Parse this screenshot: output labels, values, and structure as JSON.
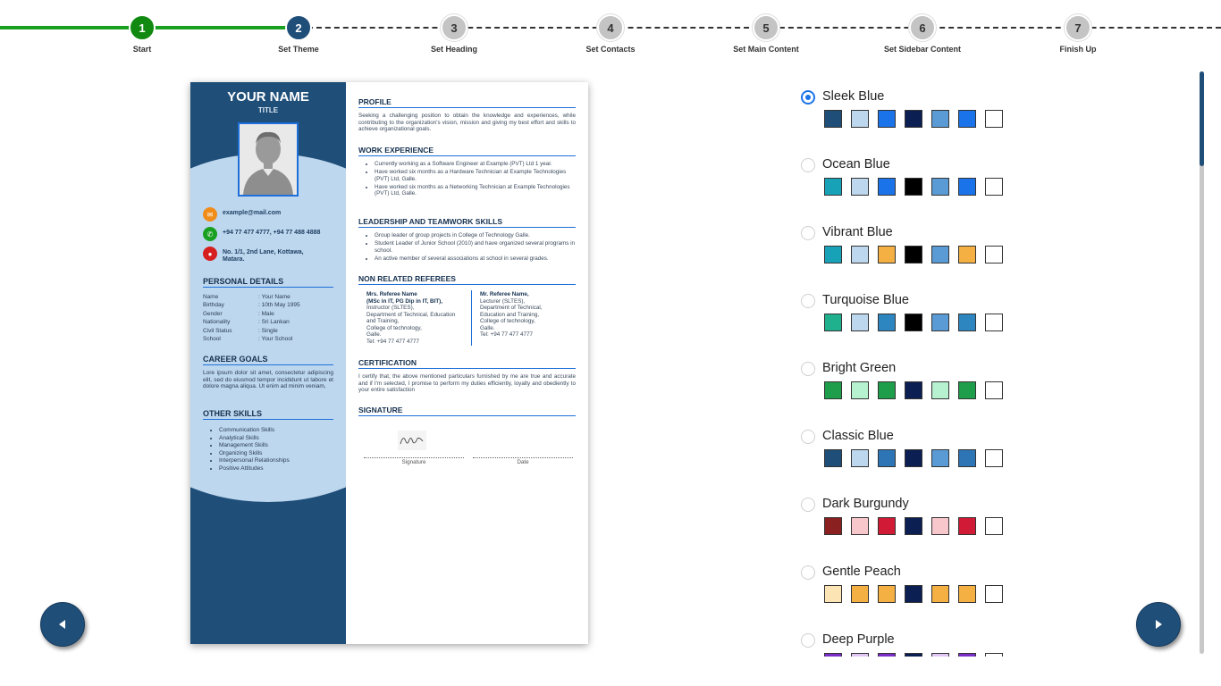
{
  "stepper": {
    "steps": [
      {
        "number": "1",
        "label": "Start",
        "state": "done"
      },
      {
        "number": "2",
        "label": "Set Theme",
        "state": "active"
      },
      {
        "number": "3",
        "label": "Set Heading",
        "state": "todo"
      },
      {
        "number": "4",
        "label": "Set Contacts",
        "state": "todo"
      },
      {
        "number": "5",
        "label": "Set Main Content",
        "state": "todo"
      },
      {
        "number": "6",
        "label": "Set Sidebar Content",
        "state": "todo"
      },
      {
        "number": "7",
        "label": "Finish Up",
        "state": "todo"
      }
    ]
  },
  "resume": {
    "name": "YOUR NAME",
    "title": "TITLE",
    "contacts": {
      "email": "example@mail.com",
      "phone": "+94 77 477 4777, +94 77 488 4888",
      "address": "No. 1/1, 2nd Lane, Kottawa, Matara."
    },
    "personal_details": {
      "heading": "PERSONAL DETAILS",
      "rows": [
        {
          "key": "Name",
          "value": ": Your Name"
        },
        {
          "key": "Birthday",
          "value": ": 10th May 1995"
        },
        {
          "key": "Gender",
          "value": ": Male"
        },
        {
          "key": "Nationality",
          "value": ": Sri Lankan"
        },
        {
          "key": "Civil Status",
          "value": ": Single"
        },
        {
          "key": "School",
          "value": ": Your School"
        }
      ]
    },
    "career_goals": {
      "heading": "CAREER GOALS",
      "text": "Lore ipsum dolor sit amet, consectetur adipiscing elit, sed do eiusmod tempor incididunt ut labore et dolore magna aliqua. Ut enim ad minim veniam,"
    },
    "other_skills": {
      "heading": "OTHER SKILLS",
      "items": [
        "Communication Skills",
        "Analytical Skills",
        "Management Skills",
        "Organizing Skills",
        "Interpersonal Relationships",
        "Positive Attitudes"
      ]
    },
    "profile": {
      "heading": "PROFILE",
      "text": "Seeking a challenging position to obtain the knowledge and experiences, while contributing to the organization's vision, mission and giving my best effort and skills to achieve organizational goals."
    },
    "work_experience": {
      "heading": "WORK EXPERIENCE",
      "items": [
        "Currently working as a Software Engineer at Example (PVT) Ltd   1 year.",
        "Have worked six months as a Hardware Technician at Example Technologies (PVT) Ltd, Galle.",
        "Have worked six months as a Networking Technician at Example Technologies (PVT) Ltd, Galle."
      ]
    },
    "leadership": {
      "heading": "LEADERSHIP AND TEAMWORK SKILLS",
      "items": [
        "Group leader of group projects in College of Technology   Galle.",
        "Student Leader of Junior School (2010) and have organized several programs in school.",
        "An active member of several associations at school in several grades."
      ]
    },
    "referees": {
      "heading": "NON RELATED REFEREES",
      "left": {
        "name": "Mrs. Referee Name",
        "quals": "(MSc in IT, PG Dip in IT, BIT),",
        "lines": [
          "Instructor (SLTES),",
          "Department of Technical, Education and Training,",
          "College of technology,",
          "Galle.",
          "Tel: +94 77 477 4777"
        ]
      },
      "right": {
        "name": "Mr. Referee Name,",
        "lines": [
          "Lecturer (SLTES),",
          "Department of Technical, Education and Training,",
          "College of technology,",
          "Galle.",
          "Tel: +94 77 477 4777"
        ]
      }
    },
    "certification": {
      "heading": "CERTIFICATION",
      "text": "I certify that, the above mentioned particulars furnished by me are true and accurate and if I'm selected, I promise to perform my duties efficiently, loyalty and obediently to your entire satisfaction"
    },
    "signature": {
      "heading": "SIGNATURE",
      "signature_label": "Signature",
      "date_label": "Date"
    }
  },
  "themes": {
    "selected": "Sleek Blue",
    "items": [
      {
        "name": "Sleek Blue",
        "colors": [
          "#1f4e79",
          "#bdd7ee",
          "#1a73e8",
          "#0b1f52",
          "#5b9bd5",
          "#1a73e8",
          "#ffffff"
        ]
      },
      {
        "name": "Ocean Blue",
        "colors": [
          "#17a2b8",
          "#bdd7ee",
          "#1a73e8",
          "#000000",
          "#5b9bd5",
          "#1a73e8",
          "#ffffff"
        ]
      },
      {
        "name": "Vibrant Blue",
        "colors": [
          "#17a2b8",
          "#bdd7ee",
          "#f4b042",
          "#000000",
          "#5b9bd5",
          "#f4b042",
          "#ffffff"
        ]
      },
      {
        "name": "Turquoise Blue",
        "colors": [
          "#1fb08e",
          "#bdd7ee",
          "#2e86c1",
          "#000000",
          "#5b9bd5",
          "#2e86c1",
          "#ffffff"
        ]
      },
      {
        "name": "Bright Green",
        "colors": [
          "#1e9e4a",
          "#b7f2d0",
          "#1e9e4a",
          "#0b1f52",
          "#b7f2d0",
          "#1e9e4a",
          "#ffffff"
        ]
      },
      {
        "name": "Classic Blue",
        "colors": [
          "#1f4e79",
          "#bdd7ee",
          "#2e75b6",
          "#0b1f52",
          "#5b9bd5",
          "#2e75b6",
          "#ffffff"
        ]
      },
      {
        "name": "Dark Burgundy",
        "colors": [
          "#8b2020",
          "#f8c7cc",
          "#d11a35",
          "#0b1f52",
          "#f8c7cc",
          "#d11a35",
          "#ffffff"
        ]
      },
      {
        "name": "Gentle Peach",
        "colors": [
          "#fde4b5",
          "#f4b042",
          "#f4b042",
          "#0b1f52",
          "#f4b042",
          "#f4b042",
          "#ffffff"
        ]
      },
      {
        "name": "Deep Purple",
        "colors": [
          "#7b2fc8",
          "#e2c7f5",
          "#7b2fc8",
          "#0b1f52",
          "#e2c7f5",
          "#7b2fc8",
          "#ffffff"
        ]
      }
    ]
  },
  "navigation": {
    "prev_icon": "triangle-left-icon",
    "next_icon": "triangle-right-icon"
  },
  "colors": {
    "accent": "#1f4e79",
    "done": "#128a12"
  }
}
